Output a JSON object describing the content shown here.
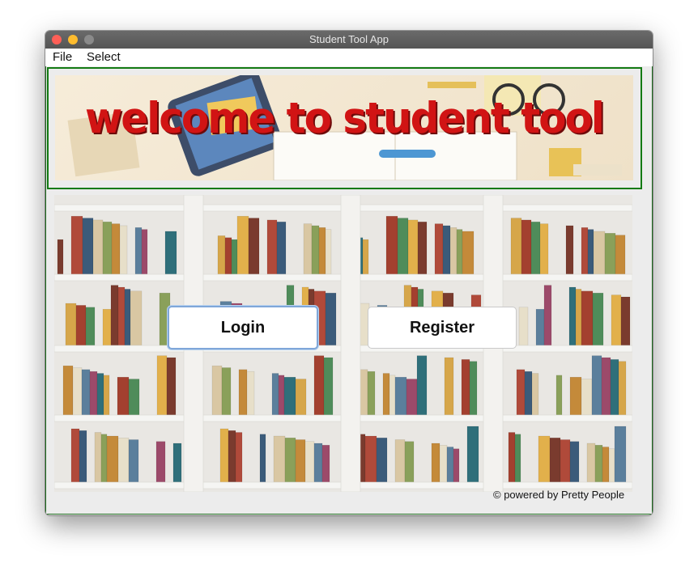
{
  "window": {
    "title": "Student Tool App"
  },
  "menubar": {
    "items": [
      "File",
      "Select"
    ]
  },
  "banner": {
    "text": "welcome to student tool"
  },
  "buttons": {
    "login": "Login",
    "register": "Register"
  },
  "footer": {
    "credit": "© powered by Pretty People"
  },
  "colors": {
    "border": "#137a13",
    "banner_text": "#d11414",
    "login_focus": "#7fa7d9"
  },
  "icons": [
    "close-light-icon",
    "minimize-light-icon",
    "maximize-light-icon"
  ]
}
